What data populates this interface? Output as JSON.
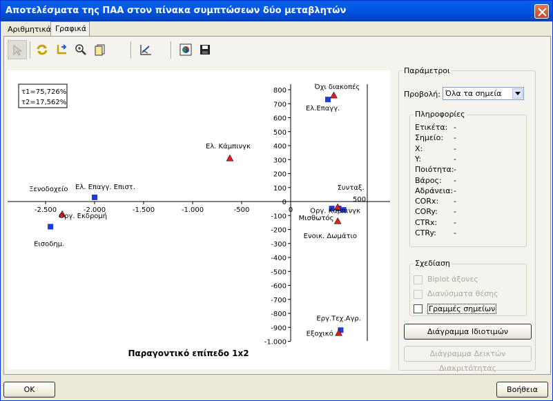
{
  "window": {
    "title": "Αποτελέσματα της ΠΑΑ στον πίνακα συμπτώσεων δύο μεταβλητών"
  },
  "tabs": [
    {
      "label": "Αριθμητικά"
    },
    {
      "label": "Γραφικά"
    }
  ],
  "toolbar": {
    "items": [
      "pointer-icon",
      "refresh-icon",
      "axes-swap-icon",
      "zoom-icon",
      "page-icon",
      "chart-settings-icon",
      "palette-icon",
      "save-icon"
    ]
  },
  "plot": {
    "tau1": "τ1=75,726%",
    "tau2": "τ2=17,562%",
    "xlabel": "Παραγοντικό επίπεδο 1x2",
    "xticks": [
      "-2.500",
      "-2.000",
      "-1.500",
      "-1.000",
      "-500",
      "0"
    ],
    "xtick_last": "500",
    "yticks": [
      "800",
      "700",
      "600",
      "500",
      "400",
      "300",
      "200",
      "100",
      "0",
      "-100",
      "-200",
      "-300",
      "-400",
      "-500",
      "-600",
      "-700",
      "-800",
      "-900",
      "-1.000"
    ],
    "colors": {
      "square": "#1f3bd6",
      "triangle": "#d91f1f"
    }
  },
  "chart_data": {
    "type": "scatter",
    "title": "",
    "xlabel": "Παραγοντικό επίπεδο 1x2",
    "ylabel": "",
    "xlim": [
      -2750,
      700
    ],
    "ylim": [
      -1050,
      850
    ],
    "series": [
      {
        "marker": "square",
        "points": [
          {
            "label": "Ελ.Επαγγ.",
            "x": 380,
            "y": 730
          },
          {
            "label": "Ελ. Επαγγ. Επιστ.",
            "x": -2000,
            "y": 30
          },
          {
            "label": "Εισοδημ.",
            "x": -2450,
            "y": -180
          },
          {
            "label": "Μισθωτός",
            "x": 420,
            "y": -50
          },
          {
            "label": "Συνταξ.",
            "x": 490,
            "y": -50
          },
          {
            "label": "Ενοικ. Δωμάτιο",
            "x": 540,
            "y": -60
          },
          {
            "label": "Εργ.Τεχ.Αγρ.",
            "x": 510,
            "y": -920
          }
        ]
      },
      {
        "marker": "triangle",
        "points": [
          {
            "label": "Όχι διακοπές",
            "x": 440,
            "y": 760
          },
          {
            "label": "Ελ. Κάμπινγκ",
            "x": -620,
            "y": 310
          },
          {
            "label": "Οργ. Εκδρομή",
            "x": -2330,
            "y": -90
          },
          {
            "label": "Ξενοδοχείο",
            "x": 480,
            "y": -40
          },
          {
            "label": "Οργ. Κάμπινγκ",
            "x": 480,
            "y": -140
          },
          {
            "label": "Εξοχικό",
            "x": 490,
            "y": -940
          }
        ]
      }
    ]
  },
  "params": {
    "title": "Παράμετροι",
    "view_label": "Προβολή:",
    "view_value": "Όλα τα σημεία",
    "info_title": "Πληροφορίες",
    "info": [
      {
        "label": "Ετικέτα:",
        "value": "-"
      },
      {
        "label": "Σημείο:",
        "value": "-"
      },
      {
        "label": "X:",
        "value": "-"
      },
      {
        "label": "Y:",
        "value": "-"
      },
      {
        "label": "Ποιότητα:",
        "value": "-"
      },
      {
        "label": "Βάρος:",
        "value": "-"
      },
      {
        "label": "Αδράνεια:",
        "value": "-"
      },
      {
        "label": "CORx:",
        "value": "-"
      },
      {
        "label": "CORy:",
        "value": "-"
      },
      {
        "label": "CTRx:",
        "value": "-"
      },
      {
        "label": "CTRy:",
        "value": "-"
      }
    ],
    "draw_title": "Σχεδίαση",
    "biplot": "Biplot άξονες",
    "vectors": "Διανύσματα θέσης",
    "point_lines": "Γραμμές σημείων",
    "eigen_button": "Διάγραμμα Ιδιοτιμών",
    "discr_button": "Διάγραμμα Δεικτών Διακριτότητας"
  },
  "footer": {
    "ok": "OK",
    "help": "Βοήθεια"
  }
}
